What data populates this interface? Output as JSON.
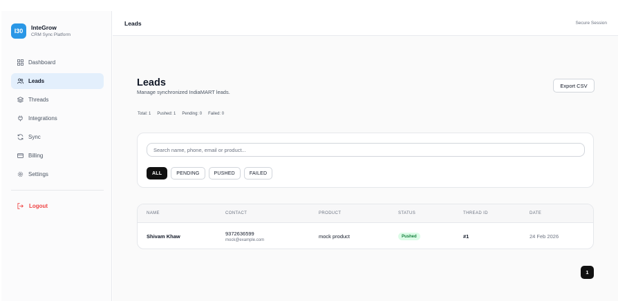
{
  "brand": {
    "logo_text": "I30",
    "name": "InteGrow",
    "subtitle": "CRM Sync Platform",
    "accent": "#2a97e6"
  },
  "sidebar": {
    "items": [
      {
        "label": "Dashboard",
        "icon": "grid-icon",
        "active": false
      },
      {
        "label": "Leads",
        "icon": "users-icon",
        "active": true
      },
      {
        "label": "Threads",
        "icon": "layers-icon",
        "active": false
      },
      {
        "label": "Integrations",
        "icon": "plug-icon",
        "active": false
      },
      {
        "label": "Sync",
        "icon": "refresh-icon",
        "active": false
      },
      {
        "label": "Billing",
        "icon": "credit-card-icon",
        "active": false
      },
      {
        "label": "Settings",
        "icon": "gear-icon",
        "active": false
      }
    ],
    "logout_label": "Logout",
    "logout_color": "#ef4444"
  },
  "topbar": {
    "title": "Leads",
    "session_label": "Secure Session"
  },
  "page": {
    "title": "Leads",
    "subtitle": "Manage synchronized IndiaMART leads.",
    "export_label": "Export CSV",
    "stats": {
      "total": "Total: 1",
      "pushed": "Pushed: 1",
      "pending": "Pending: 0",
      "failed": "Failed: 0"
    }
  },
  "filters": {
    "search_placeholder": "Search name, phone, email or product...",
    "search_value": "",
    "chips": [
      "ALL",
      "PENDING",
      "PUSHED",
      "FAILED"
    ],
    "active_chip": "ALL"
  },
  "table": {
    "columns": [
      "NAME",
      "CONTACT",
      "PRODUCT",
      "STATUS",
      "THREAD ID",
      "DATE"
    ],
    "rows": [
      {
        "name": "Shivam Khaw",
        "phone": "9372636599",
        "email": "mock@example.com",
        "product": "mock product",
        "status": "Pushed",
        "thread_id": "#1",
        "date": "24 Feb 2026"
      }
    ],
    "status_colors": {
      "Pushed": "#15803d"
    }
  },
  "pagination": {
    "current_page": "1"
  }
}
